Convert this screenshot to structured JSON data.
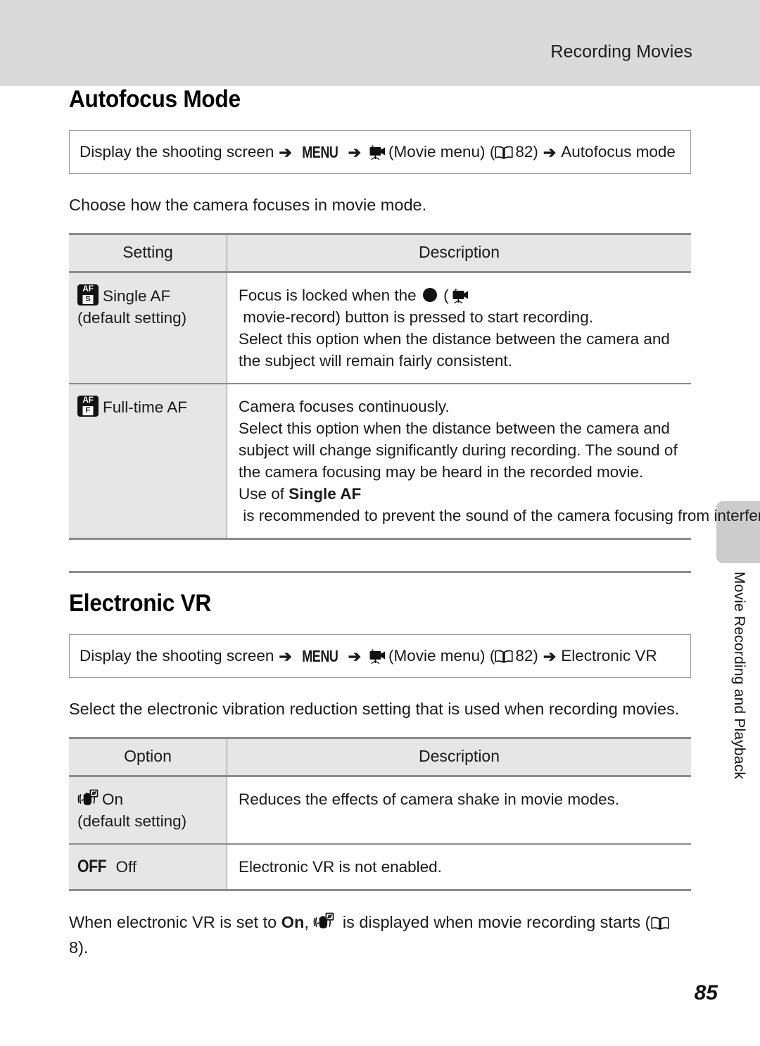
{
  "header": {
    "running_title": "Recording Movies"
  },
  "sections": [
    {
      "title": "Autofocus Mode",
      "nav_path": {
        "prefix": "Display the shooting screen",
        "arrow": "➔",
        "menu_label": "MENU",
        "movie_icon": "movie-camera-icon",
        "movie_menu_label": "(Movie menu)",
        "book_icon": "open-book-icon",
        "page_ref": "82",
        "page_ref_close": ")",
        "destination": "Autofocus mode"
      },
      "intro": "Choose how the camera focuses in movie mode.",
      "table": {
        "columns": [
          "Setting",
          "Description"
        ],
        "rows": [
          {
            "icon": "af-single-icon",
            "icon_top": "AF",
            "icon_bottom": "S",
            "label": "Single AF",
            "sub_label": "(default setting)",
            "description_parts": [
              {
                "type": "text",
                "value": "Focus is locked when the "
              },
              {
                "type": "icon",
                "value": "record-dot-icon"
              },
              {
                "type": "text",
                "value": " ("
              },
              {
                "type": "icon",
                "value": "movie-camera-icon"
              },
              {
                "type": "text",
                "value": " movie-record) button is pressed to start recording."
              },
              {
                "type": "break",
                "value": ""
              },
              {
                "type": "text",
                "value": "Select this option when the distance between the camera and the subject will remain fairly consistent."
              }
            ]
          },
          {
            "icon": "af-fulltime-icon",
            "icon_top": "AF",
            "icon_bottom": "F",
            "label": "Full-time AF",
            "sub_label": "",
            "description_parts": [
              {
                "type": "text",
                "value": "Camera focuses continuously."
              },
              {
                "type": "break",
                "value": ""
              },
              {
                "type": "text",
                "value": "Select this option when the distance between the camera and subject will change significantly during recording. The sound of the camera focusing may be heard in the recorded movie."
              },
              {
                "type": "break",
                "value": ""
              },
              {
                "type": "text",
                "value": "Use of "
              },
              {
                "type": "bold",
                "value": "Single AF"
              },
              {
                "type": "text",
                "value": " is recommended to prevent the sound of the camera focusing from interfering with recording."
              }
            ]
          }
        ]
      }
    },
    {
      "title": "Electronic VR",
      "nav_path": {
        "prefix": "Display the shooting screen",
        "arrow": "➔",
        "menu_label": "MENU",
        "movie_icon": "movie-camera-icon",
        "movie_menu_label": "(Movie menu)",
        "book_icon": "open-book-icon",
        "page_ref": "82",
        "page_ref_close": ")",
        "destination": "Electronic VR"
      },
      "intro": "Select the electronic vibration reduction setting that is used when recording movies.",
      "table": {
        "columns": [
          "Option",
          "Description"
        ],
        "rows": [
          {
            "icon": "vr-hand-icon",
            "label": "On",
            "sub_label": "(default setting)",
            "description": "Reduces the effects of camera shake in movie modes."
          },
          {
            "icon": "off-text-icon",
            "icon_text": "OFF",
            "label": "Off",
            "sub_label": "",
            "description": "Electronic VR is not enabled."
          }
        ]
      },
      "closing_note": {
        "part1": "When electronic VR is set to ",
        "bold": "On",
        "part2": ", ",
        "icon": "vr-hand-icon",
        "part3": " is displayed when movie recording starts (",
        "book_icon": "open-book-icon",
        "page_ref": "8",
        "part4": ")."
      }
    }
  ],
  "side_tab": {
    "label": "Movie Recording and Playback"
  },
  "footer": {
    "page_number": "85"
  },
  "colors": {
    "header_band": "#dadada",
    "table_header_bg": "#e6e6e6",
    "table_border": "#8c8c8c",
    "side_tab_bg": "#cccccc",
    "text": "#1a1a1a"
  }
}
